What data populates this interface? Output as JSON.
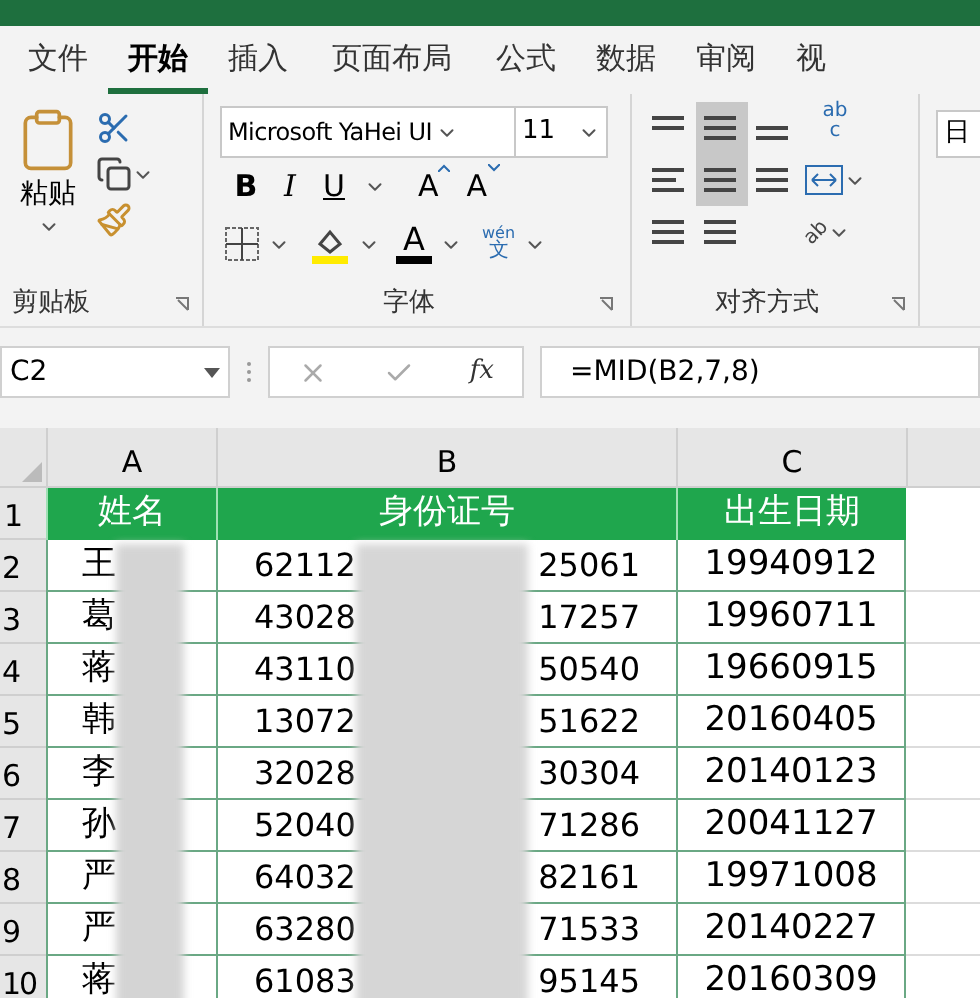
{
  "tabs": [
    {
      "label": "文件",
      "selected": false
    },
    {
      "label": "开始",
      "selected": true
    },
    {
      "label": "插入",
      "selected": false
    },
    {
      "label": "页面布局",
      "selected": false
    },
    {
      "label": "公式",
      "selected": false
    },
    {
      "label": "数据",
      "selected": false
    },
    {
      "label": "审阅",
      "selected": false
    },
    {
      "label": "视",
      "selected": false
    }
  ],
  "clipboard": {
    "paste_label": "粘贴",
    "group_label": "剪贴板"
  },
  "font": {
    "name": "Microsoft YaHei UI",
    "size": "11",
    "bold": "B",
    "italic": "I",
    "underline": "U",
    "grow": "A",
    "shrink": "A",
    "color_letter": "A",
    "phonetic_top": "wén",
    "phonetic_bottom": "文",
    "group_label": "字体"
  },
  "alignment": {
    "wrap_top": "ab",
    "wrap_bottom": "c",
    "group_label": "对齐方式",
    "orientation": "ab"
  },
  "number": {
    "format": "日"
  },
  "formula_bar": {
    "name_box": "C2",
    "fx": "fx",
    "formula": "=MID(B2,7,8)"
  },
  "columns": [
    "A",
    "B",
    "C"
  ],
  "header_row": {
    "number": "1",
    "cells": [
      "姓名",
      "身份证号",
      "出生日期"
    ]
  },
  "rows": [
    {
      "number": "2",
      "name": "王",
      "id_start": "62112",
      "id_end": "25061",
      "birth": "19940912"
    },
    {
      "number": "3",
      "name": "葛",
      "id_start": "43028",
      "id_end": "17257",
      "birth": "19960711"
    },
    {
      "number": "4",
      "name": "蒋",
      "id_start": "43110",
      "id_end": "50540",
      "birth": "19660915"
    },
    {
      "number": "5",
      "name": "韩",
      "id_start": "13072",
      "id_end": "51622",
      "birth": "20160405"
    },
    {
      "number": "6",
      "name": "李",
      "id_start": "32028",
      "id_end": "30304",
      "birth": "20140123"
    },
    {
      "number": "7",
      "name": "孙",
      "id_start": "52040",
      "id_end": "71286",
      "birth": "20041127"
    },
    {
      "number": "8",
      "name": "严",
      "id_start": "64032",
      "id_end": "82161",
      "birth": "19971008"
    },
    {
      "number": "9",
      "name": "严",
      "id_start": "63280",
      "id_end": "71533",
      "birth": "20140227"
    },
    {
      "number": "10",
      "name": "蒋",
      "id_start": "61083",
      "id_end": "95145",
      "birth": "20160309"
    }
  ]
}
